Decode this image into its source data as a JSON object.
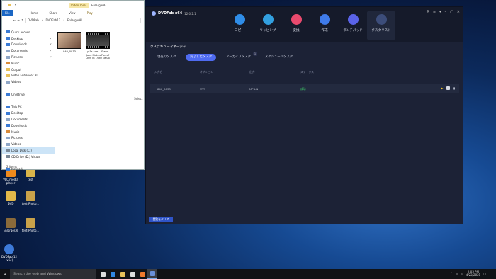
{
  "desktop_icons": [
    {
      "label": "Recy",
      "color": "#9ab7d6"
    },
    {
      "label": "Cur",
      "color": "#3a7bd5"
    },
    {
      "label": "Free",
      "color": "#b33b3b"
    },
    {
      "label": "DVD",
      "color": "#d8a43a"
    },
    {
      "label": "Vid",
      "color": "#2f66b3"
    },
    {
      "label": "VLC media player",
      "color": "#f08a1c"
    },
    {
      "label": "test",
      "color": "#d9b44a"
    },
    {
      "label": "DVD",
      "color": "#e2b84a"
    },
    {
      "label": "test-Photo...",
      "color": "#c9a24a"
    },
    {
      "label": "EnlargerAI",
      "color": "#8a6a3a"
    },
    {
      "label": "test-Photo...",
      "color": "#c9a24a"
    },
    {
      "label": "DVDFab 12 (x64)",
      "color": "#3d7ad8"
    }
  ],
  "explorer": {
    "tools_tab": "Video Tools",
    "path_label": "EnlargerAI",
    "ribbon_tabs": [
      "File",
      "Home",
      "Share",
      "View",
      "Play"
    ],
    "address": [
      "DVDFab",
      "DVDFab12",
      "EnlargerAI"
    ],
    "nav": [
      {
        "label": "Quick access",
        "icon": "star-icon",
        "color": "#3a7bd5",
        "pin": ""
      },
      {
        "label": "Desktop",
        "icon": "desktop-icon",
        "color": "#3a7bd5",
        "pin": "✔"
      },
      {
        "label": "Downloads",
        "icon": "download-icon",
        "color": "#3a7bd5",
        "pin": "✔"
      },
      {
        "label": "Documents",
        "icon": "document-icon",
        "color": "#8fa7c7",
        "pin": "✔"
      },
      {
        "label": "Pictures",
        "icon": "picture-icon",
        "color": "#8fa7c7",
        "pin": "✔"
      },
      {
        "label": "Music",
        "icon": "music-icon",
        "color": "#d98c3a",
        "pin": ""
      },
      {
        "label": "Output",
        "icon": "folder-icon",
        "color": "#e8c15a",
        "pin": ""
      },
      {
        "label": "Video Enhancer AI",
        "icon": "folder-icon",
        "color": "#e8c15a",
        "pin": ""
      },
      {
        "label": "Videos",
        "icon": "video-icon",
        "color": "#8fa7c7",
        "pin": ""
      },
      {
        "label": "",
        "icon": "",
        "color": "",
        "pin": ""
      },
      {
        "label": "OneDrive",
        "icon": "cloud-icon",
        "color": "#3a7bd5",
        "pin": ""
      },
      {
        "label": "",
        "icon": "",
        "color": "",
        "pin": ""
      },
      {
        "label": "This PC",
        "icon": "computer-icon",
        "color": "#3a7bd5",
        "pin": ""
      },
      {
        "label": "Desktop",
        "icon": "desktop-icon",
        "color": "#3a7bd5",
        "pin": ""
      },
      {
        "label": "Documents",
        "icon": "document-icon",
        "color": "#8fa7c7",
        "pin": ""
      },
      {
        "label": "Downloads",
        "icon": "download-icon",
        "color": "#3a7bd5",
        "pin": ""
      },
      {
        "label": "Music",
        "icon": "music-icon",
        "color": "#d98c3a",
        "pin": ""
      },
      {
        "label": "Pictures",
        "icon": "picture-icon",
        "color": "#8fa7c7",
        "pin": ""
      },
      {
        "label": "Videos",
        "icon": "video-icon",
        "color": "#8fa7c7",
        "pin": ""
      },
      {
        "label": "Local Disk (C:)",
        "icon": "disk-icon",
        "color": "#7a8896",
        "pin": "",
        "selected": true
      },
      {
        "label": "CD Drive (D:) Virtua",
        "icon": "cd-icon",
        "color": "#7a8896",
        "pin": ""
      },
      {
        "label": "",
        "icon": "",
        "color": "",
        "pin": ""
      },
      {
        "label": "Network",
        "icon": "network-icon",
        "color": "#3a7bd5",
        "pin": ""
      }
    ],
    "files": [
      {
        "name": "840_0033"
      },
      {
        "name": "yt1s.com - Steve Jobs Makes Fun of DOS in 1980_360p"
      }
    ],
    "side_text": "Select",
    "status": "2 items"
  },
  "dvdfab": {
    "brand": "DVDFab x64",
    "version": "12.0.2.1",
    "window_controls": [
      "⚲",
      "≡",
      "▾",
      "–",
      "▢",
      "✕"
    ],
    "modules": [
      {
        "label": "コピー",
        "icon": "copy-icon",
        "color": "#2f8de8"
      },
      {
        "label": "リッピング",
        "icon": "ripper-icon",
        "color": "#32a0e0"
      },
      {
        "label": "変換",
        "icon": "converter-icon",
        "color": "#e94a6e"
      },
      {
        "label": "作成",
        "icon": "creator-icon",
        "color": "#3f7bea"
      },
      {
        "label": "ランチパッド",
        "icon": "launchpad-icon",
        "color": "#5a63e8"
      },
      {
        "label": "タスクリスト",
        "icon": "tasklist-icon",
        "color": "#3c4d7a",
        "active": true
      }
    ],
    "panel_title": "タスクキューマネージャ",
    "tabs": [
      {
        "label": "現在のタスク",
        "active": false,
        "badge": ""
      },
      {
        "label": "完了したタスク",
        "active": true,
        "badge": ""
      },
      {
        "label": "アーカイブタスク",
        "active": false,
        "badge": "1"
      },
      {
        "label": "スケジュールタスク",
        "active": false,
        "badge": ""
      }
    ],
    "headers": [
      "入力名",
      "オプション",
      "出力",
      "ステータス"
    ],
    "row": {
      "name": "840_0033",
      "option": "????",
      "output": "MP4.N",
      "status": "成功"
    },
    "clear_button": "閲覧をクリア",
    "status_color": "#3fd36a"
  },
  "taskbar": {
    "search_placeholder": "Search the web and Windows",
    "apps": [
      {
        "icon": "task-view-icon",
        "color": "#dcdcdc"
      },
      {
        "icon": "edge-icon",
        "color": "#2f86e0"
      },
      {
        "icon": "file-explorer-icon",
        "color": "#e8c15a"
      },
      {
        "icon": "store-icon",
        "color": "#dcdcdc"
      },
      {
        "icon": "firefox-icon",
        "color": "#f07a2c"
      },
      {
        "icon": "dvdfab-icon",
        "color": "#6a8fd8",
        "active": true
      }
    ],
    "time": "2:05 PM",
    "date": "4/22/2021"
  }
}
